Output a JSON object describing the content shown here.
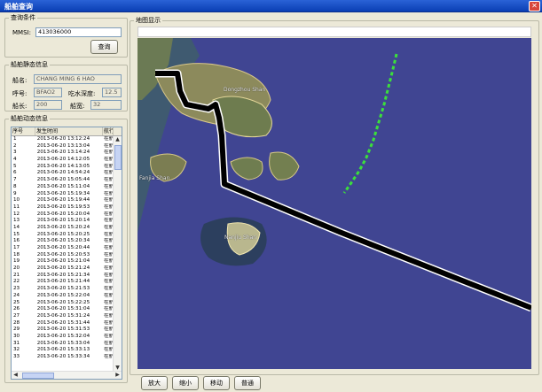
{
  "window": {
    "title": "船舶查询",
    "close_label": "✕"
  },
  "query": {
    "group_label": "查询条件",
    "mmsi_label": "MMSI:",
    "mmsi_value": "413036000",
    "query_button": "查询"
  },
  "static_info": {
    "group_label": "船舶静态信息",
    "name_label": "船名:",
    "name_value": "CHANG MING 6 HAO",
    "callsign_label": "呼号:",
    "callsign_value": "BFAO2",
    "draft_label": "吃水深度:",
    "draft_value": "12.5",
    "length_label": "船长:",
    "length_value": "200",
    "width_label": "船宽:",
    "width_value": "32"
  },
  "dynamic_info": {
    "group_label": "船舶动态信息",
    "columns": [
      "序号",
      "发生时间",
      "航行"
    ],
    "rows": [
      [
        "1",
        "2013-06-20 13:12:24",
        "在航"
      ],
      [
        "2",
        "2013-06-20 13:13:04",
        "在航"
      ],
      [
        "3",
        "2013-06-20 13:14:24",
        "在航"
      ],
      [
        "4",
        "2013-06-20 14:12:05",
        "在航"
      ],
      [
        "5",
        "2013-06-20 14:13:05",
        "在航"
      ],
      [
        "6",
        "2013-06-20 14:54:24",
        "在航"
      ],
      [
        "7",
        "2013-06-20 15:05:44",
        "在航"
      ],
      [
        "8",
        "2013-06-20 15:11:04",
        "在航"
      ],
      [
        "9",
        "2013-06-20 15:19:34",
        "在航"
      ],
      [
        "10",
        "2013-06-20 15:19:44",
        "在航"
      ],
      [
        "11",
        "2013-06-20 15:19:53",
        "在航"
      ],
      [
        "12",
        "2013-06-20 15:20:04",
        "在航"
      ],
      [
        "13",
        "2013-06-20 15:20:14",
        "在航"
      ],
      [
        "14",
        "2013-06-20 15:20:24",
        "在航"
      ],
      [
        "15",
        "2013-06-20 15:20:25",
        "在航"
      ],
      [
        "16",
        "2013-06-20 15:20:34",
        "在航"
      ],
      [
        "17",
        "2013-06-20 15:20:44",
        "在航"
      ],
      [
        "18",
        "2013-06-20 15:20:53",
        "在航"
      ],
      [
        "19",
        "2013-06-20 15:21:04",
        "在航"
      ],
      [
        "20",
        "2013-06-20 15:21:24",
        "在航"
      ],
      [
        "21",
        "2013-06-20 15:21:34",
        "在航"
      ],
      [
        "22",
        "2013-06-20 15:21:44",
        "在航"
      ],
      [
        "23",
        "2013-06-20 15:21:53",
        "在航"
      ],
      [
        "24",
        "2013-06-20 15:22:04",
        "在航"
      ],
      [
        "25",
        "2013-06-20 15:22:25",
        "在航"
      ],
      [
        "26",
        "2013-06-20 15:31:04",
        "在航"
      ],
      [
        "27",
        "2013-06-20 15:31:24",
        "在航"
      ],
      [
        "28",
        "2013-06-20 15:31:44",
        "在航"
      ],
      [
        "29",
        "2013-06-20 15:31:53",
        "在航"
      ],
      [
        "30",
        "2013-06-20 15:32:04",
        "在航"
      ],
      [
        "31",
        "2013-06-20 15:33:04",
        "在航"
      ],
      [
        "32",
        "2013-06-20 15:33:13",
        "在航"
      ],
      [
        "33",
        "2013-06-20 15:33:34",
        "在航"
      ]
    ]
  },
  "map_panel": {
    "group_label": "地图显示",
    "place_labels": [
      "Fanjia Shan",
      "Nanjiu Shan",
      "Dongzhou Shan"
    ],
    "buttons": [
      "放大",
      "缩小",
      "移动",
      "普通"
    ]
  },
  "colors": {
    "track": "#000000",
    "track_edge": "#ffffff",
    "other_vessel": "#3be03b",
    "sea": "#3b3f8c",
    "titlebar": "#0a3fb4"
  }
}
